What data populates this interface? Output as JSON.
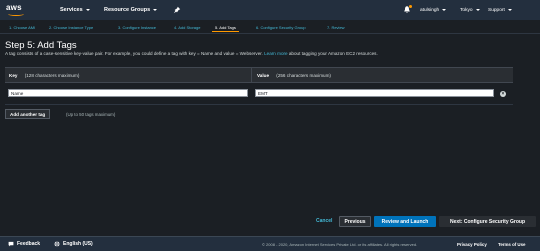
{
  "brand": {
    "logo_text": "aws"
  },
  "topnav": {
    "services": "Services",
    "resource_groups": "Resource Groups",
    "user": "atulsingh",
    "region": "Tokyo",
    "support": "Support"
  },
  "steps": [
    {
      "label": "1. Choose AMI"
    },
    {
      "label": "2. Choose Instance Type"
    },
    {
      "label": "3. Configure Instance"
    },
    {
      "label": "4. Add Storage"
    },
    {
      "label": "5. Add Tags"
    },
    {
      "label": "6. Configure Security Group"
    },
    {
      "label": "7. Review"
    }
  ],
  "page": {
    "title": "Step 5: Add Tags",
    "description": "A tag consists of a case-sensitive key-value pair. For example, you could define a tag with key = Name and value = Webserver.",
    "learn_more": "Learn more",
    "description_suffix": "about tagging your Amazon EC2 resources."
  },
  "table": {
    "key_header": "Key",
    "key_hint": "(128 characters maximum)",
    "value_header": "Value",
    "value_hint": "(256 characters maximum)",
    "rows": [
      {
        "key": "Name",
        "value": "EMT"
      }
    ]
  },
  "add_tag": {
    "button": "Add another tag",
    "hint": "(Up to 50 tags maximum)"
  },
  "actions": {
    "cancel": "Cancel",
    "previous": "Previous",
    "review_launch": "Review and Launch",
    "next": "Next: Configure Security Group"
  },
  "footer": {
    "feedback": "Feedback",
    "language": "English (US)",
    "copyright": "© 2008 - 2020, Amazon Internet Services Private Ltd. or its affiliates. All rights reserved.",
    "privacy": "Privacy Policy",
    "terms": "Terms of Use"
  },
  "colors": {
    "accent": "#ff9900",
    "link": "#44b9d6",
    "primary_button": "#0073bb",
    "nav_bg": "#232f3e"
  }
}
